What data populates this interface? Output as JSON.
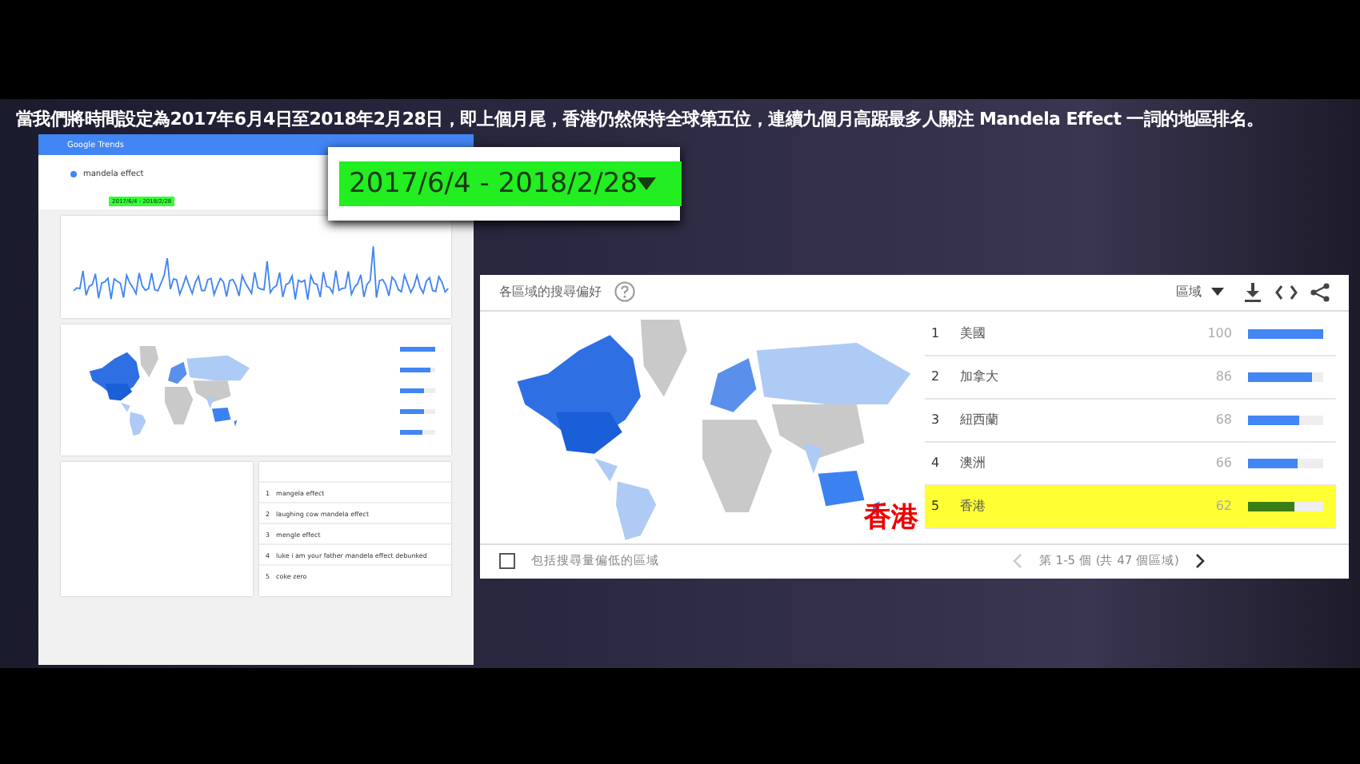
{
  "caption": "當我們將時間設定為2017年6月4日至2018年2月28日，即上個月尾，香港仍然保持全球第五位，連續九個月高踞最多人關注 Mandela Effect 一詞的地區排名。",
  "date_overlay": {
    "label": "2017/6/4 - 2018/2/28"
  },
  "thumbnail": {
    "app_title": "Google Trends",
    "search_term": "mandela effect",
    "date_chip": "2017/6/4 - 2018/2/28",
    "related_queries": [
      {
        "rank": "1",
        "query": "mangela effect"
      },
      {
        "rank": "2",
        "query": "laughing cow mandela effect"
      },
      {
        "rank": "3",
        "query": "mengle effect"
      },
      {
        "rank": "4",
        "query": "luke i am your father mandela effect debunked"
      },
      {
        "rank": "5",
        "query": "coke zero"
      }
    ]
  },
  "region_panel": {
    "title": "各區域的搜尋偏好",
    "dropdown": "區域",
    "rows": [
      {
        "rank": "1",
        "name": "美國",
        "value": "100",
        "level": 1.0,
        "highlighted": false
      },
      {
        "rank": "2",
        "name": "加拿大",
        "value": "86",
        "level": 0.86,
        "highlighted": false
      },
      {
        "rank": "3",
        "name": "紐西蘭",
        "value": "68",
        "level": 0.68,
        "highlighted": false
      },
      {
        "rank": "4",
        "name": "澳洲",
        "value": "66",
        "level": 0.66,
        "highlighted": false
      },
      {
        "rank": "5",
        "name": "香港",
        "value": "62",
        "level": 0.62,
        "highlighted": true
      }
    ],
    "checkbox": {
      "label": "包括搜尋量偏低的區域",
      "checked": false
    },
    "pagination": "第 1-5 個 (共 47 個區域)"
  },
  "callout": {
    "label": "香港"
  }
}
